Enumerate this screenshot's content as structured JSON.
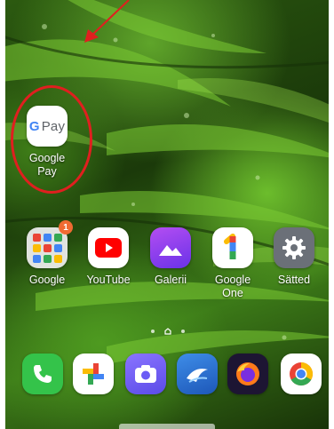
{
  "home": {
    "featured_app": {
      "label_line1": "Google",
      "label_line2": "Pay",
      "icon": "google-pay-icon",
      "icon_text": "Pay",
      "icon_g": "G"
    },
    "apps": [
      {
        "label": "Google",
        "icon": "google-folder-icon",
        "badge": "1"
      },
      {
        "label": "YouTube",
        "icon": "youtube-icon"
      },
      {
        "label": "Galerii",
        "icon": "gallery-icon"
      },
      {
        "label_line1": "Google",
        "label_line2": "One",
        "icon": "google-one-icon",
        "icon_text": "1"
      },
      {
        "label": "Sätted",
        "icon": "settings-icon"
      }
    ],
    "dock": [
      {
        "icon": "phone-icon"
      },
      {
        "icon": "google-photos-icon"
      },
      {
        "icon": "camera-icon"
      },
      {
        "icon": "samsung-internet-icon"
      },
      {
        "icon": "firefox-icon"
      },
      {
        "icon": "chrome-icon"
      }
    ]
  },
  "colors": {
    "annotation": "#e01f1f",
    "badge": "#f06a32",
    "youtube_red": "#ff0000",
    "gallery_purple": "#7b3ff2",
    "settings_gray": "#6b7078",
    "phone_green": "#34c34a",
    "camera_purple": "#6b5cf5",
    "internet_blue": "#2a6fd6"
  }
}
